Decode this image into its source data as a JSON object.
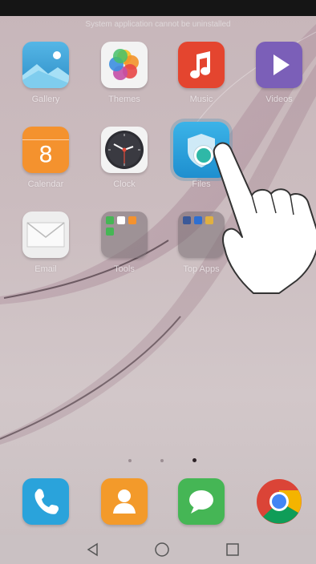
{
  "toast": {
    "text": "System application cannot be uninstalled"
  },
  "apps_row1": [
    {
      "label": "Gallery",
      "icon": "gallery-icon"
    },
    {
      "label": "Themes",
      "icon": "themes-icon"
    },
    {
      "label": "Music",
      "icon": "music-icon"
    },
    {
      "label": "Videos",
      "icon": "videos-icon"
    }
  ],
  "apps_row2": [
    {
      "label": "Calendar",
      "icon": "calendar-icon",
      "date": "8"
    },
    {
      "label": "Clock",
      "icon": "clock-icon"
    },
    {
      "label": "Files",
      "icon": "phone-manager-icon"
    }
  ],
  "apps_row3": [
    {
      "label": "Email",
      "icon": "email-icon"
    },
    {
      "label": "Tools",
      "icon": "folder-icon"
    },
    {
      "label": "Top Apps",
      "icon": "folder-icon"
    }
  ],
  "dock": [
    {
      "icon": "phone-icon"
    },
    {
      "icon": "contacts-icon"
    },
    {
      "icon": "messages-icon"
    },
    {
      "icon": "chrome-icon"
    }
  ],
  "page_indicator": {
    "pages": 3,
    "current": 3
  },
  "colors": {
    "gallery": "#4aa8d8",
    "themes": "#f2f2f2",
    "music": "#e4452f",
    "videos": "#7b5fb8",
    "calendar": "#f4922e",
    "phone": "#2aa3db",
    "contacts": "#f39a2a",
    "messages": "#45b655"
  }
}
